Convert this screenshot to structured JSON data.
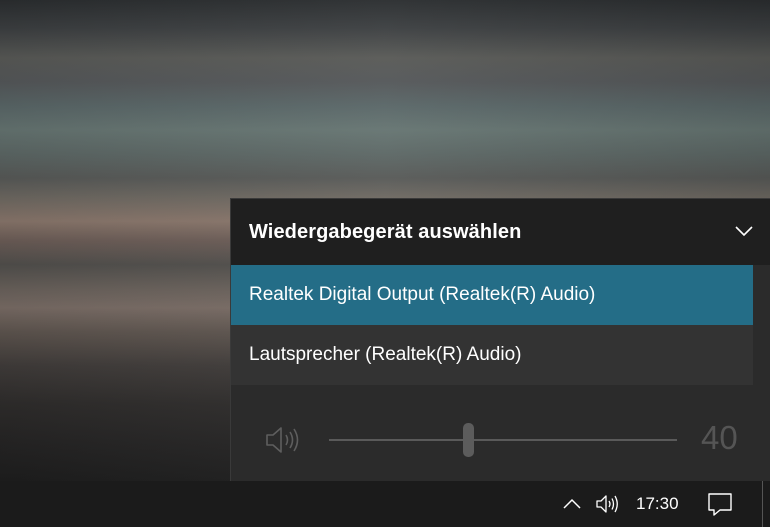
{
  "flyout": {
    "title": "Wiedergabegerät auswählen",
    "devices": [
      {
        "label": "Realtek Digital Output (Realtek(R) Audio)",
        "selected": true
      },
      {
        "label": "Lautsprecher (Realtek(R) Audio)",
        "selected": false
      }
    ],
    "volume": {
      "value": "40",
      "level_percent": 40
    },
    "colors": {
      "selected": "#246d87",
      "header": "#1f1f1f",
      "panel": "#2b2b2b"
    }
  },
  "taskbar": {
    "time": "17:30",
    "icons": [
      "chevron-up-icon",
      "speaker-icon",
      "action-center-icon"
    ]
  }
}
